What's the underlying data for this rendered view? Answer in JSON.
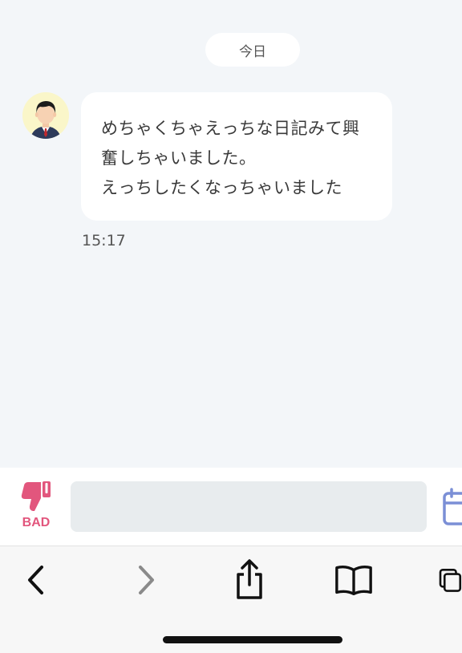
{
  "chat": {
    "date_label": "今日",
    "messages": [
      {
        "lines": [
          "めちゃくちゃえっちな日記みて興",
          "奮しちゃいました。",
          "えっちしたくなっちゃいました"
        ],
        "time": "15:17",
        "avatar_icon": "businessman-avatar-icon"
      }
    ]
  },
  "input_bar": {
    "bad_label": "BAD",
    "bad_icon": "thumbs-down-icon",
    "bad_color": "#e2567d",
    "message_value": "",
    "calendar_icon": "calendar-icon",
    "calendar_color": "#7b8fd6"
  },
  "browser_toolbar": {
    "icons": [
      "back-arrow-icon",
      "forward-arrow-icon",
      "share-icon",
      "bookmarks-book-icon",
      "tabs-icon"
    ]
  }
}
